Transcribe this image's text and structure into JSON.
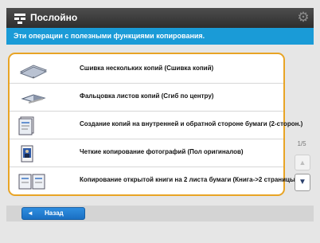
{
  "header": {
    "title": "Послойно",
    "app_icon": "layout-icon",
    "settings_icon": "gear-icon"
  },
  "banner": {
    "text": "Эти операции с полезными функциями копирования."
  },
  "options": [
    {
      "label": "Сшивка нескольких копий (Сшивка копий)",
      "icon": "copy-stack-icon"
    },
    {
      "label": "Фальцовка листов копий (Сгиб по центру)",
      "icon": "fold-icon"
    },
    {
      "label": "Создание копий на внутренней и обратной стороне бумаги (2-сторон.)",
      "icon": "duplex-icon"
    },
    {
      "label": "Четкие копирование фотографий (Пол оригиналов)",
      "icon": "photo-icon"
    },
    {
      "label": "Копирование открытой книги на 2 листа бумаги (Книга->2 страницы)",
      "icon": "book-icon"
    }
  ],
  "scroll": {
    "page_indicator": "1/5",
    "up_icon": "arrow-up-icon",
    "down_icon": "arrow-down-icon"
  },
  "footer": {
    "back_label": "Назад",
    "back_icon": "arrow-left-icon"
  }
}
